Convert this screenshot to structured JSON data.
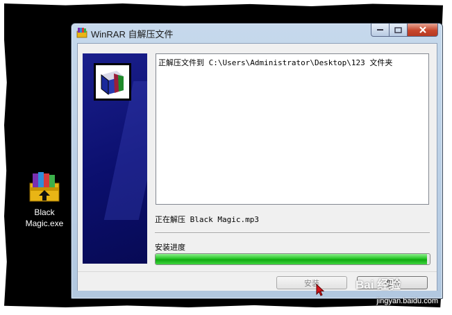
{
  "desktop": {
    "icon_label_line1": "Black",
    "icon_label_line2": "Magic.exe",
    "icon": "winrar-sfx-icon"
  },
  "window": {
    "title": "WinRAR 自解压文件",
    "title_icon": "winrar-icon",
    "log_line": "正解压文件到 C:\\Users\\Administrator\\Desktop\\123 文件夹",
    "status_text": "正在解压 Black Magic.mp3",
    "progress_label": "安装进度",
    "progress_fraction": 0.99,
    "install_button_label": "安装",
    "cancel_button_label": "取消"
  },
  "watermark": {
    "logo_text": "Bai 经验",
    "url": "jingyan.baidu.com"
  },
  "colors": {
    "banner": "#0b0f6e",
    "progress": "#1fbf1f",
    "close_button": "#c7462c"
  }
}
